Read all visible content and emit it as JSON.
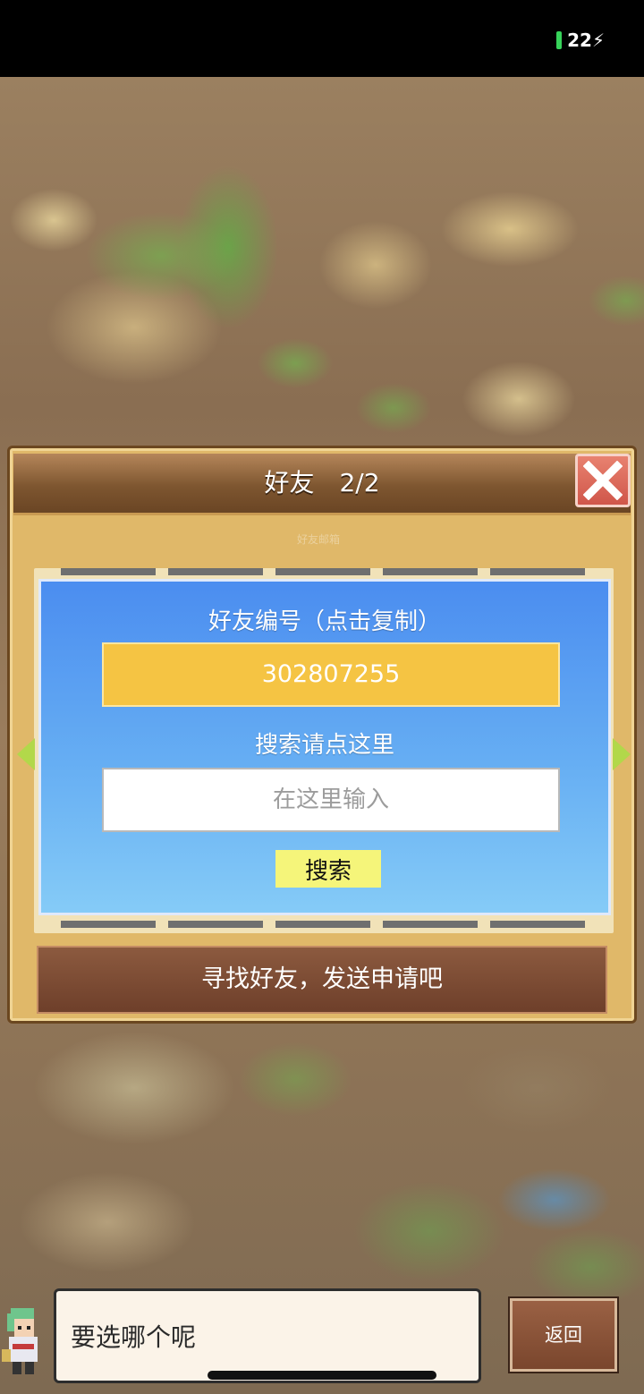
{
  "status_bar": {
    "battery": "22"
  },
  "dialog": {
    "title": "好友",
    "page": "2/2",
    "faint_subtitle": "好友邮箱",
    "card": {
      "code_label": "好友编号（点击复制）",
      "friend_code": "302807255",
      "search_label": "搜索请点这里",
      "search_placeholder": "在这里输入",
      "search_button": "搜索"
    },
    "banner": "寻找好友，发送申请吧"
  },
  "speech": {
    "text": "要选哪个呢"
  },
  "back_button": "返回",
  "icons": {
    "close": "close-x-icon",
    "left": "arrow-left-icon",
    "right": "arrow-right-icon",
    "battery": "battery-charging-icon"
  },
  "colors": {
    "card_top": "#4b8df0",
    "card_bottom": "#85cbf7",
    "code_box": "#f5c443",
    "search_button": "#f5f57a",
    "close_button": "#d0564a",
    "banner": "#6e3f2a"
  }
}
